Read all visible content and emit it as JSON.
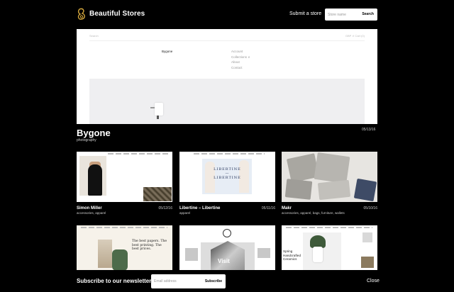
{
  "header": {
    "site_title": "Beautiful Stores",
    "submit_label": "Submit a store",
    "search_placeholder": "Store name",
    "search_button": "Search"
  },
  "featured": {
    "title": "Bygone",
    "category": "photography",
    "date": "05/13/16",
    "preview": {
      "search_text": "Search",
      "cart_text": "GBP  ∨   Cart (0)",
      "brand": "Bygone",
      "nav": [
        "Account",
        "Collections ∨",
        "About",
        "Contact"
      ]
    }
  },
  "cards": [
    {
      "title": "Simon Miller",
      "date": "05/12/16",
      "tags": "accessories, apparel"
    },
    {
      "title": "Libertine – Libertine",
      "date": "05/11/16",
      "tags": "apparel"
    },
    {
      "title": "Makr",
      "date": "05/10/16",
      "tags": "accessories, apparel, bags, furniture, wallets"
    },
    {
      "title": "",
      "date": "",
      "tags": "",
      "thumb_text": "The best papers. The best printing. The best prices."
    },
    {
      "title": "",
      "date": "",
      "tags": "",
      "thumb_text": "Visit"
    },
    {
      "title": "",
      "date": "",
      "tags": "",
      "thumb_text": "Spring Handcrafted Ceramics"
    }
  ],
  "libertine_text": [
    "LIBERTINE",
    "—",
    "LIBERTINE"
  ],
  "newsletter": {
    "label": "Subscribe to our newsletter",
    "placeholder": "Email address",
    "button": "Subscribe",
    "close": "Close"
  },
  "colors": {
    "background": "#000000",
    "logo_accent": "#d4a73c"
  }
}
